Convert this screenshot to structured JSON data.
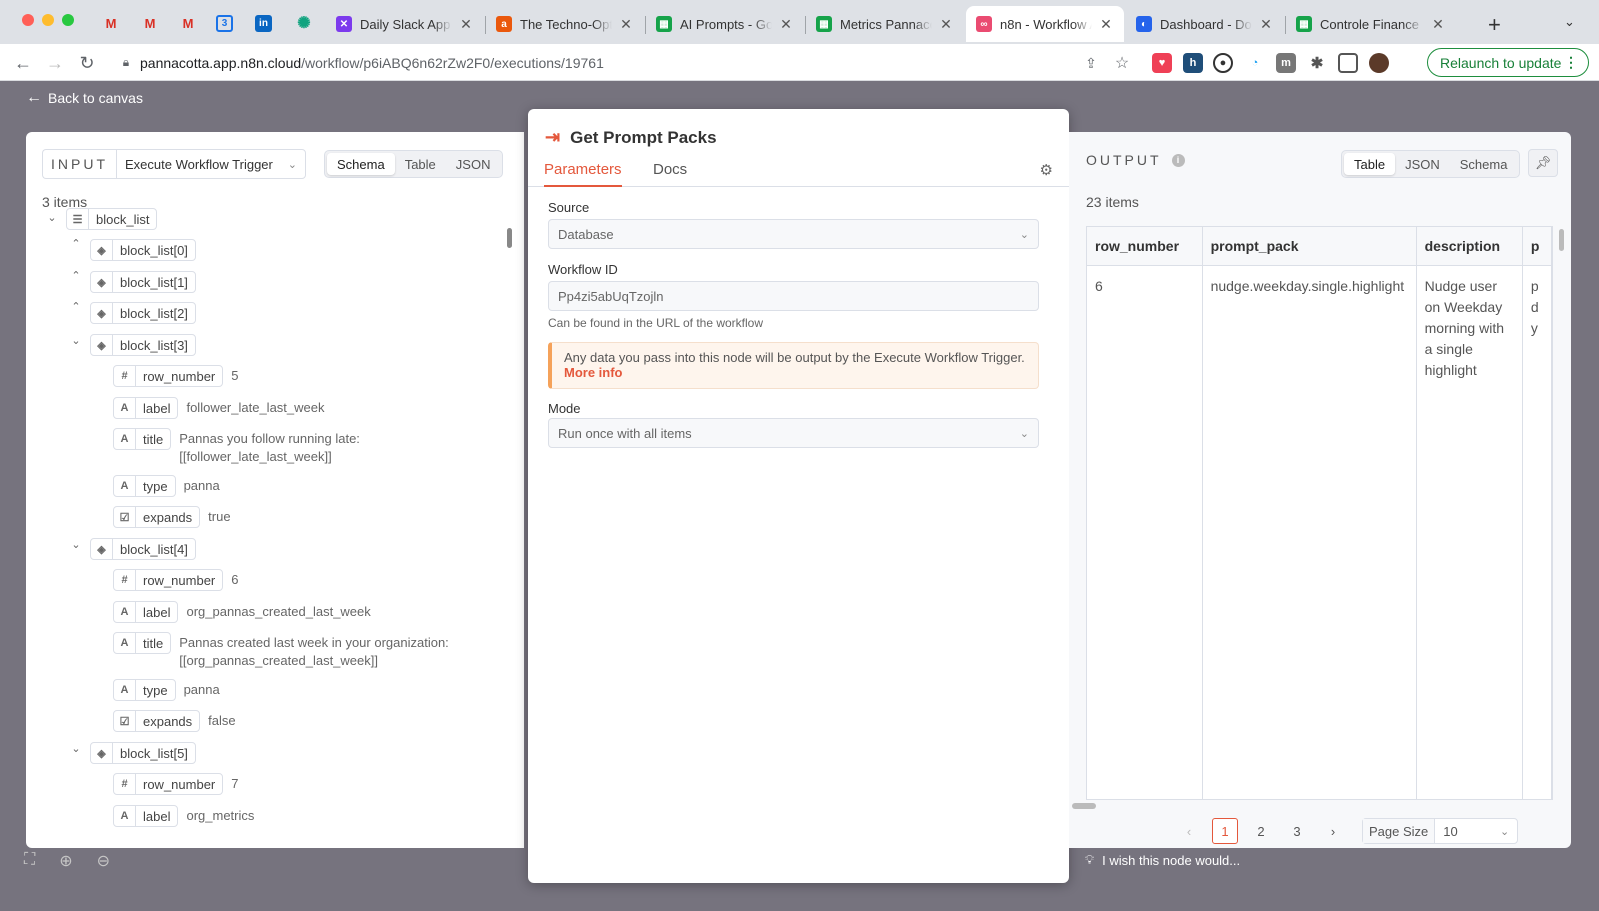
{
  "browser": {
    "tabs": [
      {
        "title": "Daily Slack App /",
        "fav": "#7c3aed",
        "glyph": "✕"
      },
      {
        "title": "The Techno-Opti",
        "fav": "#ea580c",
        "glyph": "a"
      },
      {
        "title": "AI Prompts - Goo",
        "fav": "#16a34a",
        "glyph": "▦"
      },
      {
        "title": "Metrics Pannaco",
        "fav": "#16a34a",
        "glyph": "▦"
      },
      {
        "title": "n8n - Workflow A",
        "fav": "#ea4b71",
        "glyph": "∞"
      },
      {
        "title": "Dashboard - Doc",
        "fav": "#2563eb",
        "glyph": "◐"
      },
      {
        "title": "Controle Finance",
        "fav": "#16a34a",
        "glyph": "▦"
      }
    ],
    "url_host": "pannacotta.app.n8n.cloud",
    "url_path": "/workflow/p6iABQ6n62rZw2F0/executions/19761",
    "relaunch_label": "Relaunch to update"
  },
  "app": {
    "back_label": "Back to canvas",
    "input": {
      "label": "INPUT",
      "node": "Execute Workflow Trigger",
      "views": [
        "Schema",
        "Table",
        "JSON"
      ],
      "active_view": "Schema",
      "count": "3 items",
      "tree": {
        "root": "block_list",
        "collapsed": [
          "block_list[0]",
          "block_list[1]",
          "block_list[2]"
        ],
        "block3": {
          "name": "block_list[3]",
          "row_number": "5",
          "label": "follower_late_last_week",
          "title": "Pannas you follow running late: [[follower_late_last_week]]",
          "type": "panna",
          "expands": "true"
        },
        "block4": {
          "name": "block_list[4]",
          "row_number": "6",
          "label": "org_pannas_created_last_week",
          "title": "Pannas created last week in your organization: [[org_pannas_created_last_week]]",
          "type": "panna",
          "expands": "false"
        },
        "block5": {
          "name": "block_list[5]",
          "row_number": "7",
          "label": "org_metrics"
        },
        "keys": {
          "row_number": "row_number",
          "label": "label",
          "title": "title",
          "type": "type",
          "expands": "expands"
        }
      }
    },
    "node": {
      "title": "Get Prompt Packs",
      "tabs": [
        "Parameters",
        "Docs"
      ],
      "source_label": "Source",
      "source_value": "Database",
      "workflow_id_label": "Workflow ID",
      "workflow_id_value": "Pp4zi5abUqTzojln",
      "workflow_id_hint": "Can be found in the URL of the workflow",
      "notice": "Any data you pass into this node will be output by the Execute Workflow Trigger.",
      "notice_link": "More info",
      "mode_label": "Mode",
      "mode_value": "Run once with all items"
    },
    "output": {
      "label": "OUTPUT",
      "views": [
        "Table",
        "JSON",
        "Schema"
      ],
      "active_view": "Table",
      "count": "23 items",
      "columns": [
        "row_number",
        "prompt_pack",
        "description",
        "p"
      ],
      "row": {
        "row_number": "6",
        "prompt_pack": "nudge.weekday.single.highlight",
        "description": "Nudge user on Weekday morning with a single highlight",
        "p": "p\nd\ny"
      },
      "pages": [
        "1",
        "2",
        "3"
      ],
      "active_page": "1",
      "page_size_label": "Page Size",
      "page_size": "10"
    },
    "feedback": "I wish this node would..."
  }
}
